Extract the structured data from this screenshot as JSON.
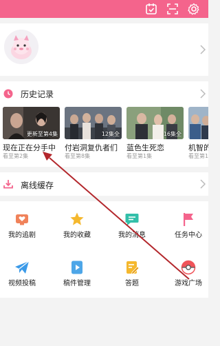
{
  "topbar": {
    "icons": [
      "calendar-check-icon",
      "scan-icon",
      "gear-icon"
    ],
    "background": "#f4648c"
  },
  "history": {
    "title": "历史记录",
    "items": [
      {
        "title": "现在正在分手中",
        "progress": "看至第2集",
        "badge": "更新至第4集"
      },
      {
        "title": "付岩洞复仇者们",
        "progress": "看至第8集",
        "badge": "12集全"
      },
      {
        "title": "蓝色生死恋",
        "progress": "看至第1集",
        "badge": "16集全"
      },
      {
        "title": "机智的监",
        "progress": "看至第1集",
        "badge": ""
      }
    ]
  },
  "offline": {
    "title": "离线缓存"
  },
  "grid": {
    "items": [
      {
        "label": "我的追剧",
        "icon": "tv-heart-icon",
        "color": "#f0825a"
      },
      {
        "label": "我的收藏",
        "icon": "star-icon",
        "color": "#f5b82e"
      },
      {
        "label": "我的消息",
        "icon": "chat-icon",
        "color": "#33bfa9"
      },
      {
        "label": "任务中心",
        "icon": "flag-icon",
        "color": "#f4648c"
      },
      {
        "label": "视频投稿",
        "icon": "paper-plane-icon",
        "color": "#3b9ae8"
      },
      {
        "label": "稿件管理",
        "icon": "play-doc-icon",
        "color": "#4da6e8"
      },
      {
        "label": "答题",
        "icon": "pencil-doc-icon",
        "color": "#f5b82e"
      },
      {
        "label": "游戏广场",
        "icon": "gamepad-icon",
        "color": "#f0545a"
      }
    ]
  },
  "annotation_color": "#b3272c"
}
